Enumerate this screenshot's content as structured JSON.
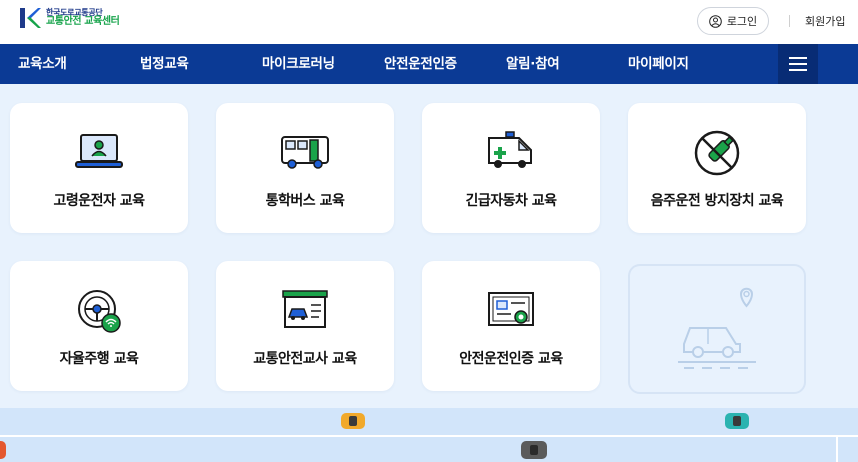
{
  "header": {
    "logo_top": "한국도로교통공단",
    "logo_bottom": "교통안전 교육센터",
    "login_label": "로그인",
    "signup_label": "회원가입"
  },
  "nav": {
    "items": [
      "교육소개",
      "법정교육",
      "마이크로러닝",
      "안전운전인증",
      "알림·참여",
      "마이페이지"
    ]
  },
  "cards": [
    {
      "label": "고령운전자 교육",
      "icon": "laptop-elderly-icon"
    },
    {
      "label": "통학버스 교육",
      "icon": "school-bus-icon"
    },
    {
      "label": "긴급자동차 교육",
      "icon": "ambulance-icon"
    },
    {
      "label": "음주운전 방지장치 교육",
      "icon": "no-drinking-icon"
    },
    {
      "label": "자율주행 교육",
      "icon": "steering-wifi-icon"
    },
    {
      "label": "교통안전교사 교육",
      "icon": "traffic-board-icon"
    },
    {
      "label": "안전운전인증 교육",
      "icon": "certificate-icon"
    }
  ],
  "colors": {
    "nav_bg": "#0b3a95",
    "main_bg": "#e8f2fd",
    "accent_green": "#1aa34a",
    "accent_blue": "#1e5fd6"
  }
}
